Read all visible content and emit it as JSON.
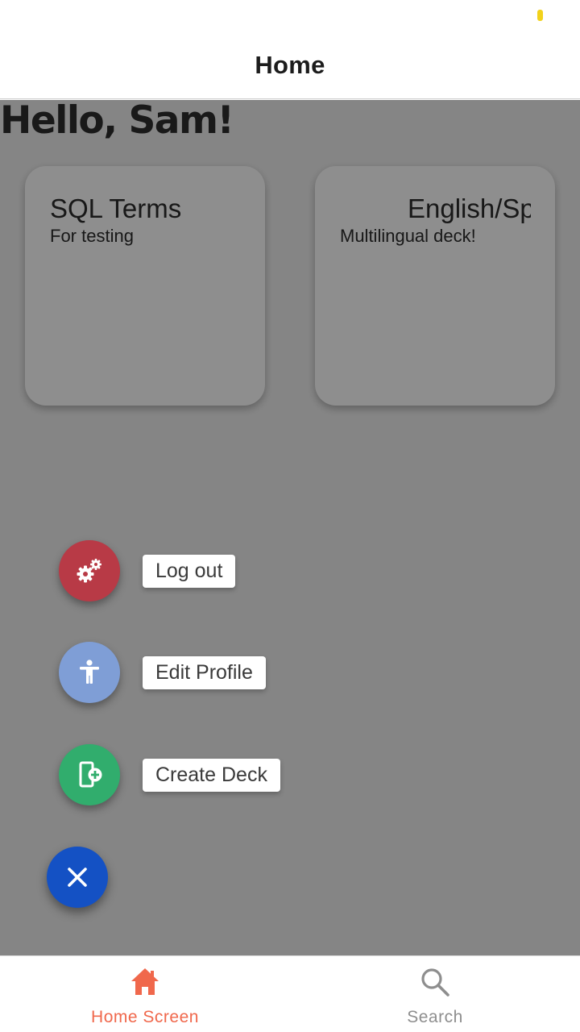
{
  "nav": {
    "title": "Home"
  },
  "greeting": "Hello, Sam!",
  "decks": [
    {
      "title": "SQL Terms",
      "description": "For testing"
    },
    {
      "title": "English/Spanish",
      "description": "Multilingual deck!"
    }
  ],
  "fab_actions": [
    {
      "label": "Log out",
      "icon": "gears-icon",
      "color": "#b83a46"
    },
    {
      "label": "Edit Profile",
      "icon": "accessibility-person-icon",
      "color": "#7f9ed6"
    },
    {
      "label": "Create Deck",
      "icon": "add-card-icon",
      "color": "#31ad6d"
    }
  ],
  "fab_main": {
    "icon": "close-icon",
    "color": "#1451c4"
  },
  "tabs": [
    {
      "label": "Home Screen",
      "icon": "home-icon",
      "active": true,
      "color": "#f0684c"
    },
    {
      "label": "Search",
      "icon": "search-icon",
      "active": false,
      "color": "#8e8e8e"
    }
  ],
  "colors": {
    "overlay": "rgba(0,0,0,0.42)",
    "status_dot": "#f2d21b"
  }
}
